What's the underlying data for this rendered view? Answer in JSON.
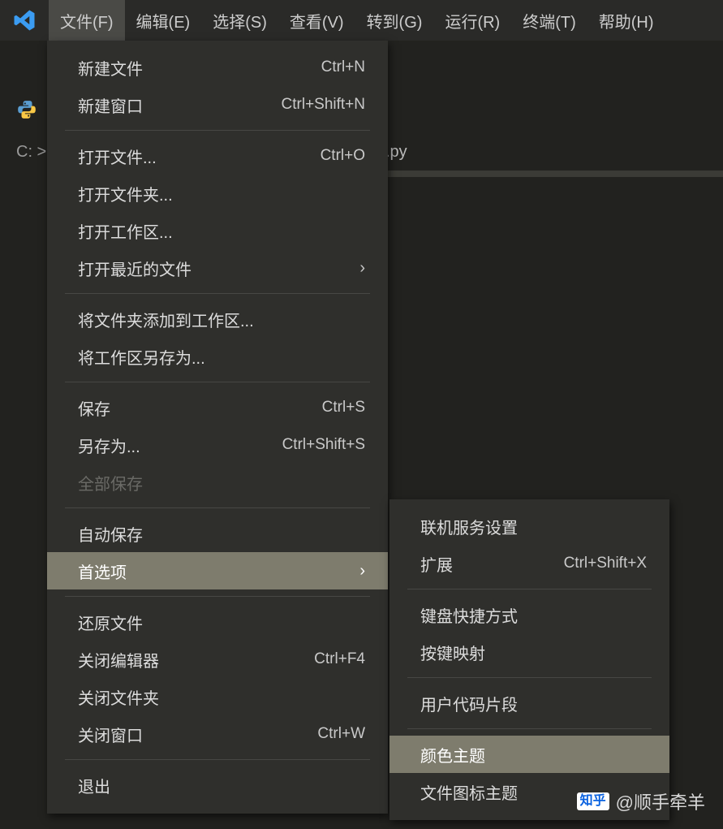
{
  "menubar": {
    "items": [
      {
        "label": "文件(F)"
      },
      {
        "label": "编辑(E)"
      },
      {
        "label": "选择(S)"
      },
      {
        "label": "查看(V)"
      },
      {
        "label": "转到(G)"
      },
      {
        "label": "运行(R)"
      },
      {
        "label": "终端(T)"
      },
      {
        "label": "帮助(H)"
      }
    ]
  },
  "breadcrumb": {
    "prefix": "C: >",
    "suffix": ".py"
  },
  "filemenu": {
    "new_file": "新建文件",
    "new_file_sc": "Ctrl+N",
    "new_window": "新建窗口",
    "new_window_sc": "Ctrl+Shift+N",
    "open_file": "打开文件...",
    "open_file_sc": "Ctrl+O",
    "open_folder": "打开文件夹...",
    "open_workspace": "打开工作区...",
    "open_recent": "打开最近的文件",
    "add_folder": "将文件夹添加到工作区...",
    "save_workspace_as": "将工作区另存为...",
    "save": "保存",
    "save_sc": "Ctrl+S",
    "save_as": "另存为...",
    "save_as_sc": "Ctrl+Shift+S",
    "save_all": "全部保存",
    "autosave": "自动保存",
    "preferences": "首选项",
    "revert": "还原文件",
    "close_editor": "关闭编辑器",
    "close_editor_sc": "Ctrl+F4",
    "close_folder": "关闭文件夹",
    "close_window": "关闭窗口",
    "close_window_sc": "Ctrl+W",
    "exit": "退出"
  },
  "prefmenu": {
    "online_settings": "联机服务设置",
    "extensions": "扩展",
    "extensions_sc": "Ctrl+Shift+X",
    "keyboard_shortcuts": "键盘快捷方式",
    "keymaps": "按键映射",
    "user_snippets": "用户代码片段",
    "color_theme": "颜色主题",
    "file_icon_theme": "文件图标主题"
  },
  "watermark": {
    "brand": "知乎",
    "text": "@顺手牵羊"
  }
}
